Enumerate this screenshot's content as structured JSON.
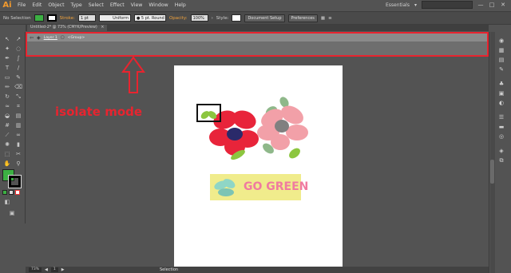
{
  "app": {
    "logo": "Ai"
  },
  "menu": [
    "File",
    "Edit",
    "Object",
    "Type",
    "Select",
    "Effect",
    "View",
    "Window",
    "Help"
  ],
  "workspace": {
    "label": "Essentials",
    "dropdown": "▾"
  },
  "window_buttons": [
    "—",
    "□",
    "✕"
  ],
  "control": {
    "selection_label": "No Selection",
    "stroke_label": "Stroke:",
    "stroke_weight": "1 pt",
    "profile_label": "Uniform",
    "brush_label": "5 pt. Round",
    "opacity_label": "Opacity:",
    "opacity_value": "100%",
    "style_label": "Style:",
    "doc_setup": "Document Setup",
    "preferences": "Preferences",
    "fill_color": "#3cb043"
  },
  "document": {
    "tab_title": "Untitled-2* @ 73% (CMYK/Preview)",
    "close": "×"
  },
  "isolation": {
    "layer": "Layer 1",
    "group": "<Group>"
  },
  "annotation": {
    "text": "isolate mode",
    "color": "#e8242f"
  },
  "artwork": {
    "slogan": "GO GREEN",
    "slogan_color": "#f07ba0",
    "banner_color": "#f0ec8c"
  },
  "status": {
    "zoom": "73%",
    "page": "1",
    "mode": "Selection"
  },
  "colors": {
    "fill": "#3cb043",
    "stroke": "#000000",
    "flower_red": "#e8243a",
    "flower_pink": "#f2a0a8",
    "leaf": "#8cc63f",
    "center_navy": "#2a2a6a",
    "center_gray": "#808080"
  }
}
